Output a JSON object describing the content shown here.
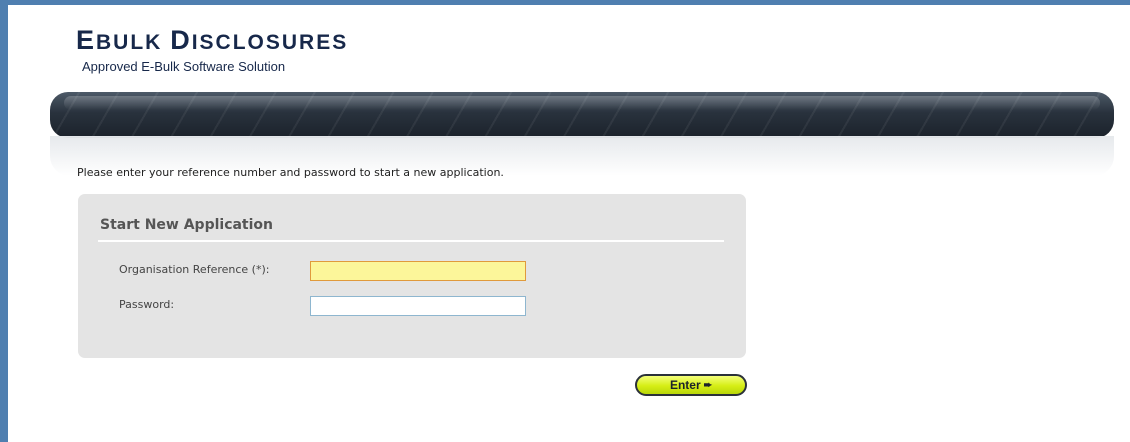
{
  "header": {
    "logo": {
      "title_segments": [
        {
          "text": "E",
          "size": "big"
        },
        {
          "text": "BULK ",
          "size": "small"
        },
        {
          "text": "D",
          "size": "big"
        },
        {
          "text": "ISCLOSURES",
          "size": "small"
        }
      ],
      "subtitle": "Approved E-Bulk Software Solution"
    }
  },
  "main": {
    "intro_text": "Please enter your reference number and password to start a new application.",
    "form": {
      "title": "Start New Application",
      "org_ref_label": "Organisation Reference (*):",
      "org_ref_value": "",
      "password_label": "Password:",
      "password_value": ""
    },
    "enter_button": {
      "label": "Enter",
      "icon": "arrow-right-icon"
    }
  },
  "colors": {
    "frame": "#4f7fb0",
    "brand_text": "#17284a",
    "banner_dark": "#29323d",
    "panel_bg": "#e4e4e4",
    "required_field_bg": "#fcf69a",
    "button_bg": "#d6ee15"
  }
}
